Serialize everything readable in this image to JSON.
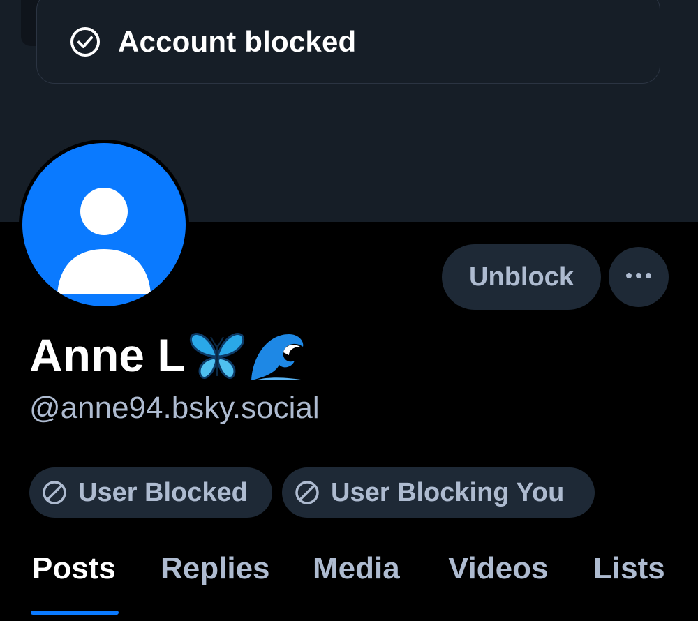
{
  "toast": {
    "icon": "check-circle-icon",
    "text": "Account blocked"
  },
  "profile": {
    "avatar_icon": "default-user-avatar-icon",
    "display_name": "Anne L",
    "name_emoji": [
      "butterfly-emoji-icon",
      "wave-emoji-icon"
    ],
    "handle": "@anne94.bsky.social"
  },
  "actions": {
    "unblock_label": "Unblock",
    "more_icon": "ellipsis-icon"
  },
  "labels": [
    {
      "icon": "block-icon",
      "text": "User Blocked"
    },
    {
      "icon": "block-icon",
      "text": "User Blocking You"
    }
  ],
  "tabs": [
    {
      "label": "Posts",
      "active": true
    },
    {
      "label": "Replies",
      "active": false
    },
    {
      "label": "Media",
      "active": false
    },
    {
      "label": "Videos",
      "active": false
    },
    {
      "label": "Lists",
      "active": false
    }
  ],
  "colors": {
    "background": "#000000",
    "banner": "#161e27",
    "surface": "#1e2936",
    "muted_text": "#aebbd0",
    "accent": "#0a7aff"
  }
}
